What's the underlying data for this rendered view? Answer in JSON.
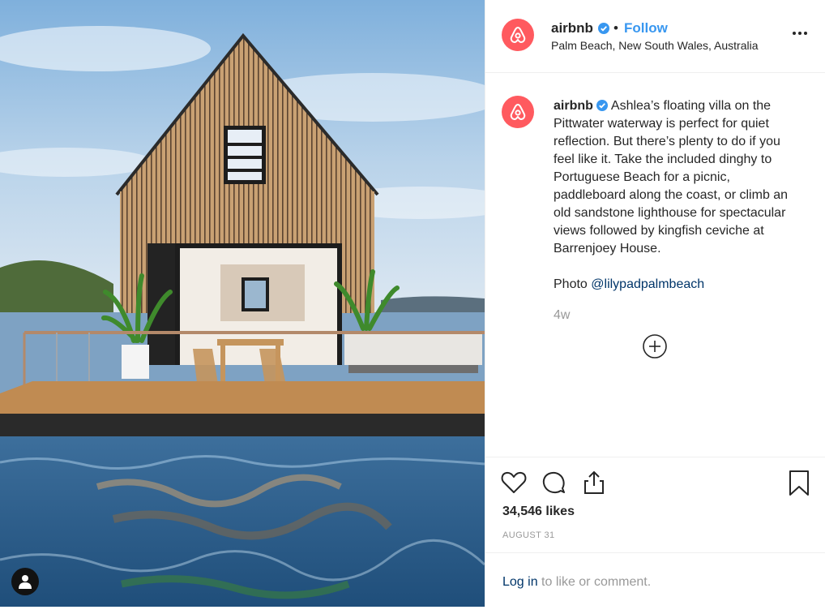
{
  "colors": {
    "brand": "#ff5a5f",
    "link": "#3897f0",
    "dark_link": "#003569",
    "muted": "#999999",
    "text": "#262626",
    "verified": "#3897f0"
  },
  "photo": {
    "image_subject": "floating wooden villa on water",
    "user_tag_icon": "user-icon"
  },
  "header": {
    "avatar_icon": "airbnb-logo-icon",
    "username": "airbnb",
    "verified_icon": "verified-badge-icon",
    "separator": "•",
    "follow_label": "Follow",
    "location": "Palm Beach, New South Wales, Australia",
    "more_icon": "more-options-icon"
  },
  "caption": {
    "username": "airbnb",
    "text": "Ashlea’s floating villa on the Pittwater waterway is perfect for quiet reflection. But there’s plenty to do if you feel like it. Take the included dinghy to Portuguese Beach for a picnic, paddleboard along the coast, or climb an old sandstone lighthouse for spectacular views followed by kingfish ceviche at Barrenjoey House.",
    "credit_prefix": "Photo",
    "credit_handle": "@lilypadpalmbeach",
    "time": "4w",
    "load_more_icon": "plus-circle-icon"
  },
  "actions": {
    "like_icon": "heart-icon",
    "comment_icon": "comment-icon",
    "share_icon": "share-icon",
    "save_icon": "bookmark-icon"
  },
  "likes": "34,546 likes",
  "date": "AUGUST 31",
  "comment_box": {
    "login_label": "Log in",
    "rest": " to like or comment."
  }
}
